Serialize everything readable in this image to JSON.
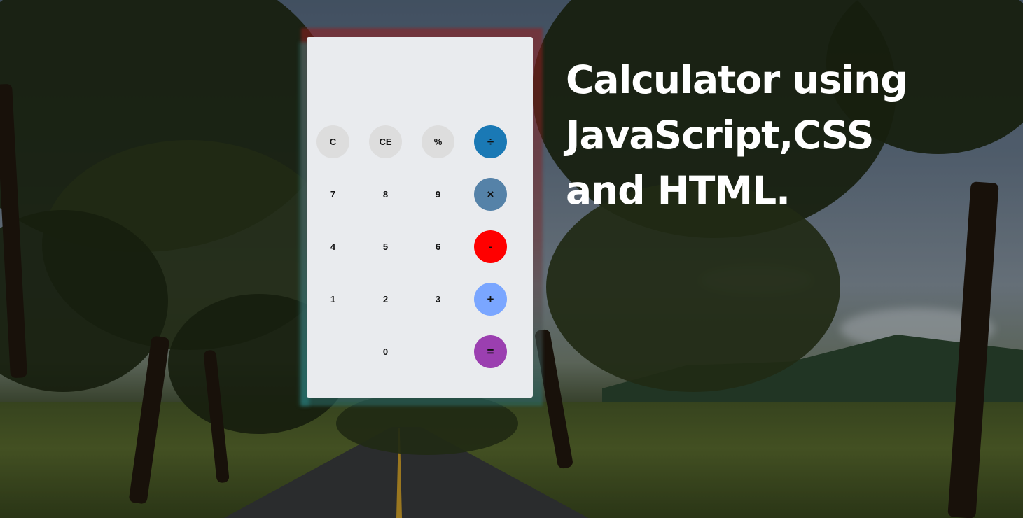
{
  "heading": {
    "line1": "Calculator using",
    "line2": "JavaScript,CSS",
    "line3": "and HTML."
  },
  "display": {
    "value": ""
  },
  "keys": [
    {
      "id": "clear",
      "label": "C",
      "kind": "func"
    },
    {
      "id": "clear-entry",
      "label": "CE",
      "kind": "func"
    },
    {
      "id": "percent",
      "label": "%",
      "kind": "func"
    },
    {
      "id": "divide",
      "label": "÷",
      "kind": "op",
      "color": "#1a79b5"
    },
    {
      "id": "7",
      "label": "7",
      "kind": "num"
    },
    {
      "id": "8",
      "label": "8",
      "kind": "num"
    },
    {
      "id": "9",
      "label": "9",
      "kind": "num"
    },
    {
      "id": "multiply",
      "label": "×",
      "kind": "op",
      "color": "#5582a8"
    },
    {
      "id": "4",
      "label": "4",
      "kind": "num"
    },
    {
      "id": "5",
      "label": "5",
      "kind": "num"
    },
    {
      "id": "6",
      "label": "6",
      "kind": "num"
    },
    {
      "id": "minus",
      "label": "-",
      "kind": "op",
      "color": "#ff0000"
    },
    {
      "id": "1",
      "label": "1",
      "kind": "num"
    },
    {
      "id": "2",
      "label": "2",
      "kind": "num"
    },
    {
      "id": "3",
      "label": "3",
      "kind": "num"
    },
    {
      "id": "plus",
      "label": "+",
      "kind": "op",
      "color": "#7aa6ff"
    },
    {
      "id": "0",
      "label": "0",
      "kind": "num"
    },
    {
      "id": "equals",
      "label": "=",
      "kind": "op",
      "color": "#9b3fb0"
    }
  ]
}
